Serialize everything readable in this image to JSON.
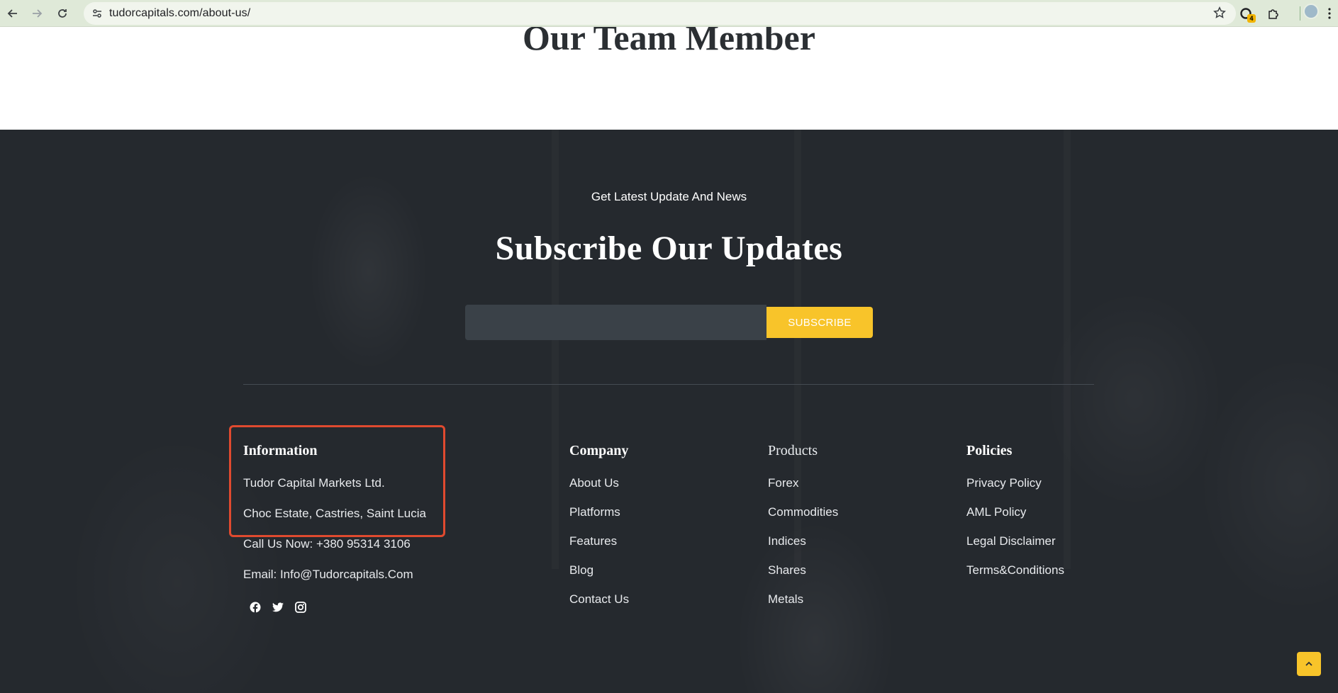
{
  "browser": {
    "url": "tudorcapitals.com/about-us/",
    "extension_badge": "4"
  },
  "team": {
    "title": "Our Team Member"
  },
  "subscribe": {
    "kicker": "Get Latest Update And News",
    "headline": "Subscribe Our Updates",
    "email_value": "",
    "button_label": "SUBSCRIBE"
  },
  "information": {
    "title": "Information",
    "company": "Tudor Capital Markets Ltd.",
    "address": "Choc Estate, Castries, Saint Lucia",
    "phone": "Call Us Now: +380 95314 3106",
    "email": "Email: Info@Tudorcapitals.Com"
  },
  "company_col": {
    "title": "Company",
    "links": [
      "About Us",
      "Platforms",
      "Features",
      "Blog",
      "Contact Us"
    ]
  },
  "products_col": {
    "title": "Products",
    "links": [
      "Forex",
      "Commodities",
      "Indices",
      "Shares",
      "Metals"
    ]
  },
  "policies_col": {
    "title": "Policies",
    "links": [
      "Privacy Policy",
      "AML Policy",
      "Legal Disclaimer",
      "Terms&Conditions"
    ]
  },
  "socials": [
    "facebook-icon",
    "twitter-icon",
    "instagram-icon"
  ],
  "colors": {
    "footer_bg": "#25292e",
    "accent": "#f8c42a",
    "highlight": "#e04a2f"
  }
}
